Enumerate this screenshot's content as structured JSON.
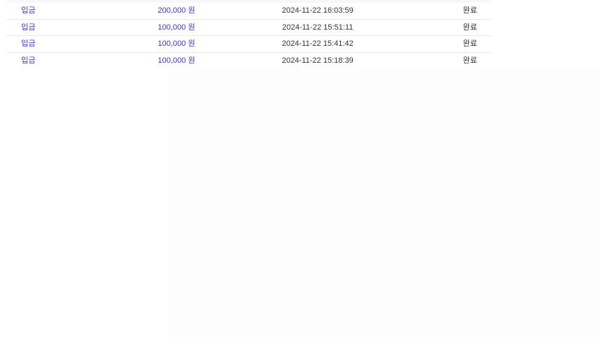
{
  "transactions": [
    {
      "type": "입금",
      "amount": "200,000 원",
      "datetime": "2024-11-22 16:03:59",
      "status": "완료"
    },
    {
      "type": "입금",
      "amount": "100,000 원",
      "datetime": "2024-11-22 15:51:11",
      "status": "완료"
    },
    {
      "type": "입금",
      "amount": "100,000 원",
      "datetime": "2024-11-22 15:41:42",
      "status": "완료"
    },
    {
      "type": "입금",
      "amount": "100,000 원",
      "datetime": "2024-11-22 15:18:39",
      "status": "완료"
    }
  ],
  "colors": {
    "type_text": "#3b35c4",
    "amount_text": "#3b35c4",
    "neutral_text": "#333333",
    "row_divider": "#e6e6ea"
  }
}
